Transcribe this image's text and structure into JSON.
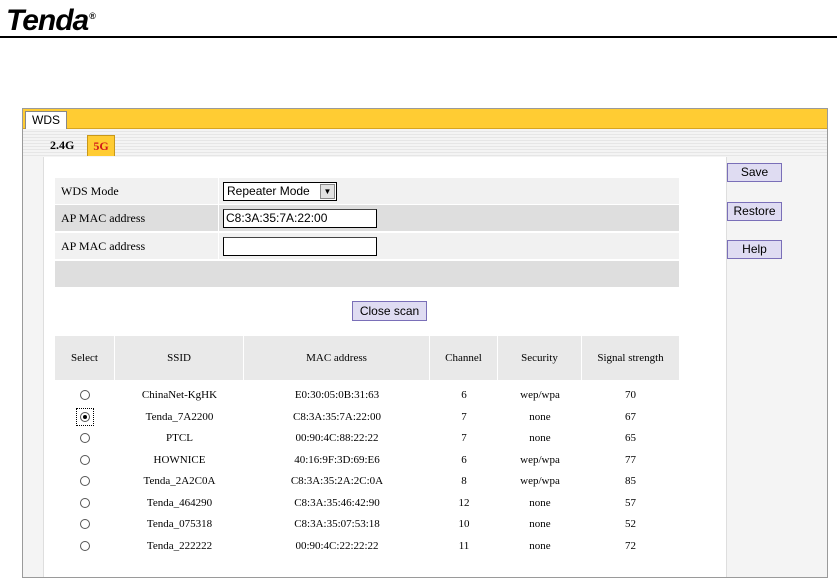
{
  "brand": {
    "logo_text": "Tenda",
    "trademark": "®"
  },
  "tabs": {
    "main": "WDS",
    "band_24": "2.4G",
    "band_5g": "5G"
  },
  "form": {
    "wds_mode_label": "WDS Mode",
    "wds_mode_value": "Repeater Mode",
    "ap_mac_label_1": "AP MAC address",
    "ap_mac_value_1": "C8:3A:35:7A:22:00",
    "ap_mac_label_2": "AP MAC address",
    "ap_mac_value_2": ""
  },
  "scan_button": "Close scan",
  "table": {
    "headers": [
      "Select",
      "SSID",
      "MAC address",
      "Channel",
      "Security",
      "Signal strength"
    ],
    "rows": [
      {
        "selected": false,
        "ssid": "ChinaNet-KgHK",
        "mac": "E0:30:05:0B:31:63",
        "channel": "6",
        "security": "wep/wpa",
        "signal": "70"
      },
      {
        "selected": true,
        "ssid": "Tenda_7A2200",
        "mac": "C8:3A:35:7A:22:00",
        "channel": "7",
        "security": "none",
        "signal": "67"
      },
      {
        "selected": false,
        "ssid": "PTCL",
        "mac": "00:90:4C:88:22:22",
        "channel": "7",
        "security": "none",
        "signal": "65"
      },
      {
        "selected": false,
        "ssid": "HOWNICE",
        "mac": "40:16:9F:3D:69:E6",
        "channel": "6",
        "security": "wep/wpa",
        "signal": "77"
      },
      {
        "selected": false,
        "ssid": "Tenda_2A2C0A",
        "mac": "C8:3A:35:2A:2C:0A",
        "channel": "8",
        "security": "wep/wpa",
        "signal": "85"
      },
      {
        "selected": false,
        "ssid": "Tenda_464290",
        "mac": "C8:3A:35:46:42:90",
        "channel": "12",
        "security": "none",
        "signal": "57"
      },
      {
        "selected": false,
        "ssid": "Tenda_075318",
        "mac": "C8:3A:35:07:53:18",
        "channel": "10",
        "security": "none",
        "signal": "52"
      },
      {
        "selected": false,
        "ssid": "Tenda_222222",
        "mac": "00:90:4C:22:22:22",
        "channel": "11",
        "security": "none",
        "signal": "72"
      }
    ]
  },
  "side_buttons": {
    "save": "Save",
    "restore": "Restore",
    "help": "Help"
  },
  "colors": {
    "tab_bar": "#ffcc33",
    "active_band_text": "#d21a1a",
    "button_bg": "#dfdcf2",
    "button_border": "#7a6fb8"
  },
  "icons": {
    "dropdown": "chevron-down-icon",
    "radio": "radio-button-icon"
  }
}
